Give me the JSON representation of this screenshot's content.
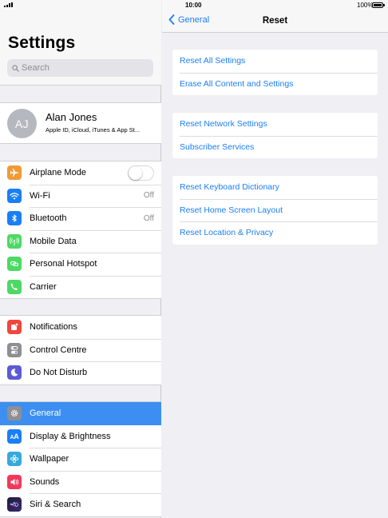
{
  "status": {
    "time": "10:00",
    "battery": "100%"
  },
  "sidebar": {
    "title": "Settings",
    "search_placeholder": "Search",
    "profile": {
      "initials": "AJ",
      "name": "Alan Jones",
      "subtitle": "Apple ID, iCloud, iTunes & App St..."
    },
    "groups": [
      [
        {
          "label": "Airplane Mode",
          "icon": "airplane-icon",
          "color": "#f19a37",
          "toggle": true
        },
        {
          "label": "Wi-Fi",
          "icon": "wifi-icon",
          "color": "#1a7ef5",
          "value": "Off"
        },
        {
          "label": "Bluetooth",
          "icon": "bluetooth-icon",
          "color": "#1a7ef5",
          "value": "Off"
        },
        {
          "label": "Mobile Data",
          "icon": "antenna-icon",
          "color": "#4cd964"
        },
        {
          "label": "Personal Hotspot",
          "icon": "link-icon",
          "color": "#4cd964"
        },
        {
          "label": "Carrier",
          "icon": "phone-icon",
          "color": "#4cd964"
        }
      ],
      [
        {
          "label": "Notifications",
          "icon": "notifications-icon",
          "color": "#f2453d"
        },
        {
          "label": "Control Centre",
          "icon": "switches-icon",
          "color": "#8e8e93"
        },
        {
          "label": "Do Not Disturb",
          "icon": "moon-icon",
          "color": "#5b5bd6"
        }
      ],
      [
        {
          "label": "General",
          "icon": "gear-icon",
          "color": "#8e8e93",
          "selected": true
        },
        {
          "label": "Display & Brightness",
          "icon": "text-size-icon",
          "color": "#1a7ef5"
        },
        {
          "label": "Wallpaper",
          "icon": "flower-icon",
          "color": "#35aadc"
        },
        {
          "label": "Sounds",
          "icon": "speaker-icon",
          "color": "#f2385a"
        },
        {
          "label": "Siri & Search",
          "icon": "siri-icon",
          "color": "#1c1c3a"
        }
      ]
    ]
  },
  "detail": {
    "back_label": "General",
    "title": "Reset",
    "groups": [
      [
        "Reset All Settings",
        "Erase All Content and Settings"
      ],
      [
        "Reset Network Settings",
        "Subscriber Services"
      ],
      [
        "Reset Keyboard Dictionary",
        "Reset Home Screen Layout",
        "Reset Location & Privacy"
      ]
    ]
  }
}
